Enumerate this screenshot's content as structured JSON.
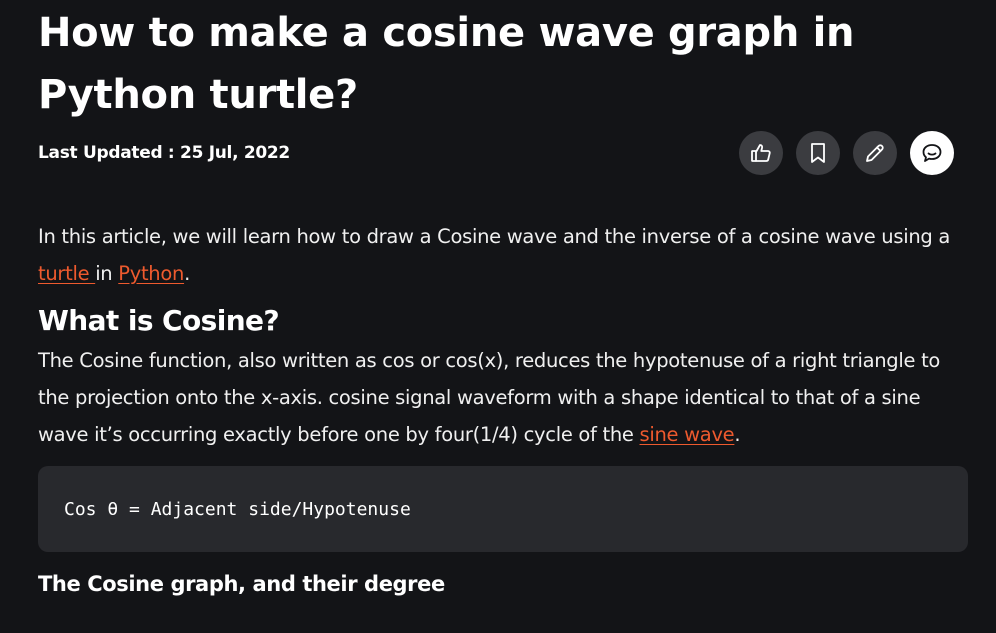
{
  "article": {
    "title": "How to make a cosine wave graph in Python turtle?",
    "last_updated": "Last Updated : 25 Jul, 2022",
    "intro": {
      "text_before": "In this article, we will learn how to draw a Cosine wave and the inverse of a cosine wave using a ",
      "link1": "turtle ",
      "text_middle": "in ",
      "link2": "Python",
      "text_after": "."
    },
    "section_heading": "What is Cosine?",
    "section_paragraph": {
      "text": "The Cosine function, also written as cos or cos(x), reduces the hypotenuse of a right triangle to the projection onto the x-axis. cosine signal waveform with a shape identical to that of a sine wave it’s occurring exactly before one by four(1/4) cycle of the ",
      "link": "sine wave",
      "text_after": "."
    },
    "code": "Cos θ = Adjacent side/Hypotenuse",
    "subheading": "The Cosine graph, and their degree"
  },
  "actions": [
    {
      "icon": "thumbs-up-icon",
      "label": "like"
    },
    {
      "icon": "bookmark-icon",
      "label": "bookmark"
    },
    {
      "icon": "pencil-icon",
      "label": "edit"
    },
    {
      "icon": "comment-icon",
      "label": "comment"
    }
  ],
  "colors": {
    "background": "#131417",
    "link": "#ee5a2e",
    "code_background": "#28292d",
    "action_button": "#3b3c40"
  }
}
